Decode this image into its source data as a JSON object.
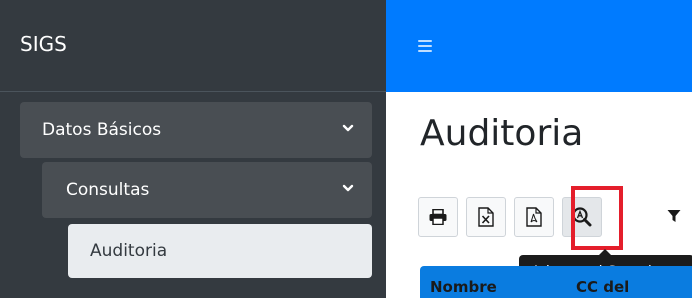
{
  "brand": "SIGS",
  "sidebar": {
    "items": [
      {
        "label": "Datos Básicos",
        "icon": "chevron-down-icon"
      },
      {
        "label": "Consultas",
        "icon": "chevron-down-icon"
      },
      {
        "label": "Auditoria"
      }
    ]
  },
  "topbar": {
    "menu_icon": "hamburger-menu-icon",
    "color": "#007bff"
  },
  "page": {
    "title": "Auditoria"
  },
  "toolbar": {
    "buttons": [
      {
        "name": "print",
        "icon": "print-icon"
      },
      {
        "name": "excel",
        "icon": "excel-file-icon"
      },
      {
        "name": "pdf",
        "icon": "pdf-file-icon"
      },
      {
        "name": "advanced-search",
        "icon": "advanced-search-icon"
      },
      {
        "name": "filter",
        "icon": "filter-icon"
      }
    ],
    "tooltip": "Advanced Search",
    "highlight_color": "#e41e2b"
  },
  "table": {
    "headers": [
      "Nombre",
      "CC del"
    ],
    "header_color": "#0a7ce0"
  }
}
